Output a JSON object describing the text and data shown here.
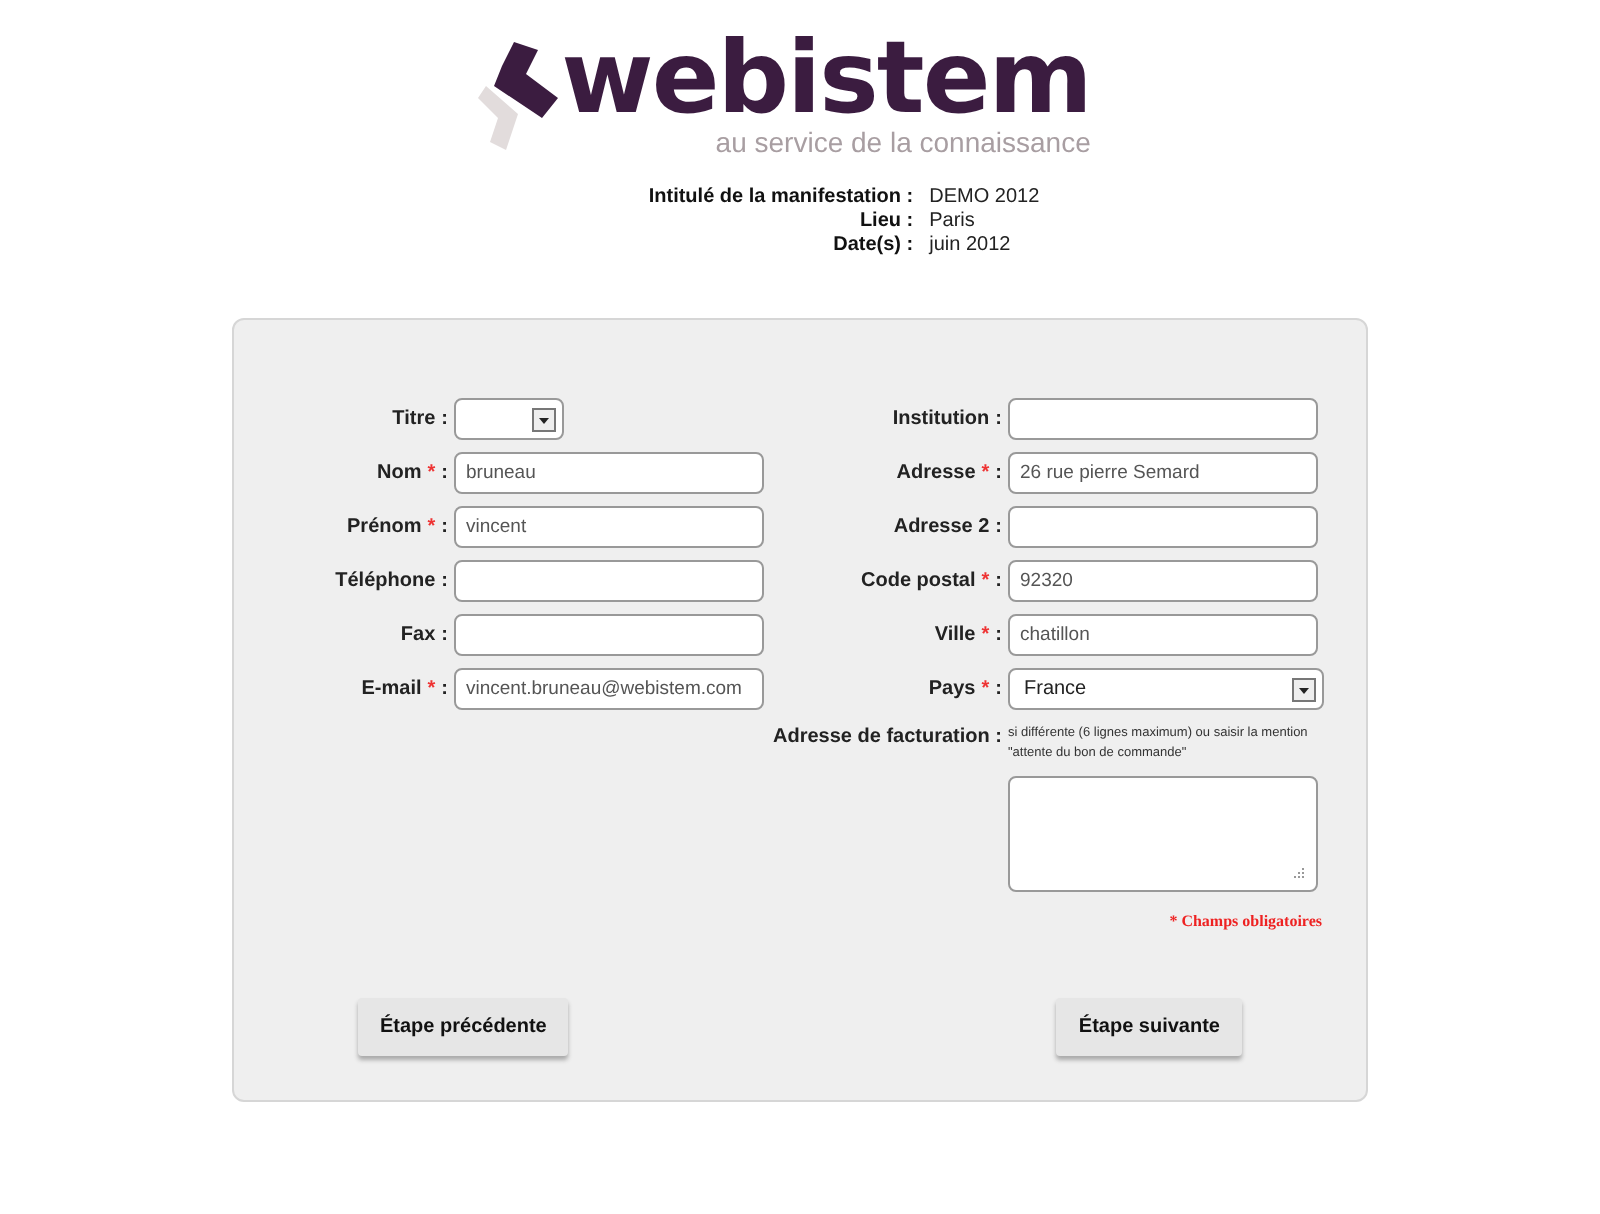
{
  "logo": {
    "name": "webistem",
    "tagline": "au service de la connaissance"
  },
  "event": [
    {
      "label": "Intitulé de la manifestation :",
      "value": "DEMO 2012"
    },
    {
      "label": "Lieu :",
      "value": "Paris"
    },
    {
      "label": "Date(s) :",
      "value": "juin 2012"
    }
  ],
  "left_fields": [
    {
      "label": "Titre",
      "colon": ":",
      "kind": "select"
    },
    {
      "label": "Nom",
      "mark": "*",
      "colon": ":",
      "kind": "text",
      "value": "bruneau"
    },
    {
      "label": "Prénom",
      "mark": "*",
      "colon": ":",
      "kind": "text",
      "value": "vincent"
    },
    {
      "label": "Téléphone",
      "colon": ":",
      "kind": "text"
    },
    {
      "label": "Fax",
      "colon": ":",
      "kind": "text"
    },
    {
      "label": "E-mail",
      "mark": "*",
      "colon": ":",
      "kind": "text",
      "value": "vincent.bruneau@webistem.com"
    }
  ],
  "right_fields": [
    {
      "label": "Institution",
      "colon": ":",
      "kind": "text"
    },
    {
      "label": "Adresse",
      "mark": "*",
      "colon": ":",
      "kind": "text",
      "value": "26 rue pierre Semard"
    },
    {
      "label": "Adresse 2",
      "colon": ":",
      "kind": "text"
    },
    {
      "label": "Code postal",
      "mark": "*",
      "colon": ":",
      "kind": "text",
      "value": "92320"
    },
    {
      "label": "Ville",
      "mark": "*",
      "colon": ":",
      "kind": "text",
      "value": "chatillon"
    },
    {
      "label": "Pays",
      "mark": "*",
      "colon": ":",
      "kind": "select",
      "value": "France"
    }
  ],
  "billing": {
    "label": "Adresse de facturation :",
    "hint": "si différente (6 lignes maximum) ou saisir la mention \"attente du bon de commande\""
  },
  "required_note": "* Champs obligatoires",
  "buttons": {
    "previous": "Étape précédente",
    "next": "Étape suivante"
  }
}
